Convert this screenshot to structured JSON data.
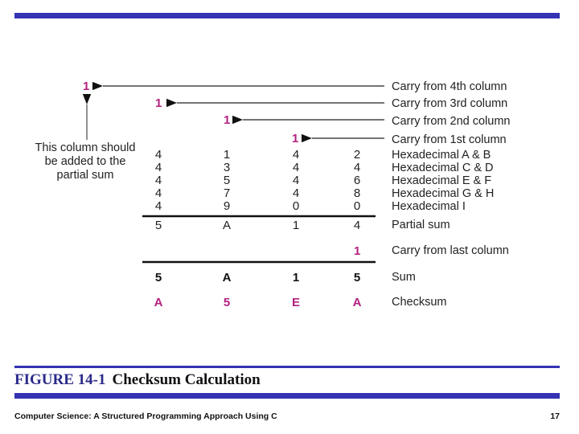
{
  "carries": {
    "from_4th": "1",
    "from_3rd": "1",
    "from_2nd": "1",
    "from_1st": "1",
    "from_last": "1"
  },
  "note": "This column should be added to the partial sum",
  "labels": {
    "carry_4th": "Carry from 4th column",
    "carry_3rd": "Carry from 3rd column",
    "carry_2nd": "Carry from 2nd column",
    "carry_1st": "Carry from 1st column",
    "partial_sum": "Partial sum",
    "carry_last": "Carry from last column",
    "sum": "Sum",
    "checksum": "Checksum"
  },
  "rows": [
    {
      "digits": [
        "4",
        "1",
        "4",
        "2"
      ],
      "label": "Hexadecimal A & B"
    },
    {
      "digits": [
        "4",
        "3",
        "4",
        "4"
      ],
      "label": "Hexadecimal C & D"
    },
    {
      "digits": [
        "4",
        "5",
        "4",
        "6"
      ],
      "label": "Hexadecimal E & F"
    },
    {
      "digits": [
        "4",
        "7",
        "4",
        "8"
      ],
      "label": "Hexadecimal G & H"
    },
    {
      "digits": [
        "4",
        "9",
        "0",
        "0"
      ],
      "label": "Hexadecimal  I"
    }
  ],
  "partial_sum": [
    "5",
    "A",
    "1",
    "4"
  ],
  "sum": [
    "5",
    "A",
    "1",
    "5"
  ],
  "checksum": [
    "A",
    "5",
    "E",
    "A"
  ],
  "caption": {
    "figure": "FIGURE 14-1",
    "title": "Checksum Calculation"
  },
  "footer": {
    "book": "Computer Science: A Structured Programming Approach Using C",
    "page": "17"
  },
  "colors": {
    "accent_bar": "#3333b3",
    "carry_magenta": "#b3207f"
  }
}
